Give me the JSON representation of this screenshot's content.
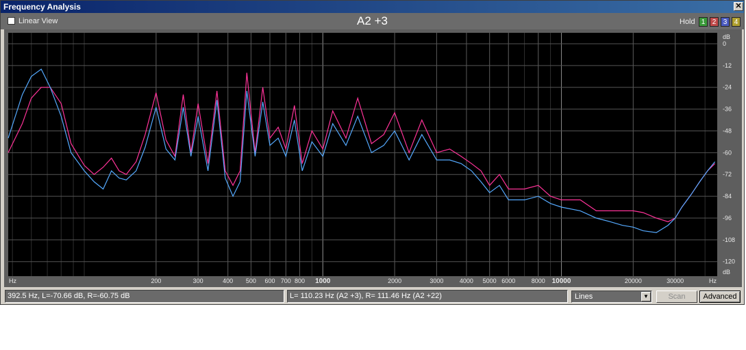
{
  "window": {
    "title": "Frequency Analysis"
  },
  "toolbar": {
    "linear_view_label": "Linear View",
    "linear_view_checked": false,
    "note_label": "A2 +3",
    "hold_label": "Hold",
    "hold_buttons": [
      {
        "label": "1",
        "color": "#3a9a3a"
      },
      {
        "label": "2",
        "color": "#c04a4a"
      },
      {
        "label": "3",
        "color": "#4a5ac0"
      },
      {
        "label": "4",
        "color": "#b0a030"
      }
    ]
  },
  "colors": {
    "left_channel": "#ff3399",
    "right_channel": "#55aaff",
    "plot_bg": "#000000",
    "grid": "#555555"
  },
  "chart_data": {
    "type": "line",
    "x_scale": "log",
    "x_range": [
      48,
      45000
    ],
    "y_range": [
      -128,
      6
    ],
    "x_axis_label": "Hz",
    "y_axis_label": "dB",
    "x_ticks": [
      {
        "label": "200",
        "value": 200
      },
      {
        "label": "300",
        "value": 300
      },
      {
        "label": "400",
        "value": 400
      },
      {
        "label": "500",
        "value": 500
      },
      {
        "label": "600",
        "value": 600
      },
      {
        "label": "700",
        "value": 700
      },
      {
        "label": "800",
        "value": 800
      },
      {
        "label": "1000",
        "value": 1000
      },
      {
        "label": "2000",
        "value": 2000
      },
      {
        "label": "3000",
        "value": 3000
      },
      {
        "label": "4000",
        "value": 4000
      },
      {
        "label": "5000",
        "value": 5000
      },
      {
        "label": "6000",
        "value": 6000
      },
      {
        "label": "8000",
        "value": 8000
      },
      {
        "label": "10000",
        "value": 10000
      },
      {
        "label": "20000",
        "value": 20000
      },
      {
        "label": "30000",
        "value": 30000
      }
    ],
    "y_ticks": [
      "0",
      "-12",
      "-24",
      "-36",
      "-48",
      "-60",
      "-72",
      "-84",
      "-96",
      "-108",
      "-120"
    ],
    "series": [
      {
        "name": "L",
        "x": [
          48,
          55,
          60,
          66,
          72,
          80,
          88,
          100,
          110,
          120,
          130,
          140,
          150,
          165,
          180,
          200,
          220,
          240,
          260,
          280,
          300,
          330,
          360,
          390,
          420,
          450,
          480,
          520,
          560,
          600,
          650,
          700,
          760,
          820,
          900,
          1000,
          1100,
          1250,
          1400,
          1600,
          1800,
          2000,
          2300,
          2600,
          3000,
          3400,
          3800,
          4200,
          4600,
          5000,
          5500,
          6000,
          7000,
          8000,
          9000,
          10000,
          12000,
          14000,
          16000,
          18000,
          20000,
          22000,
          25000,
          28000,
          30000,
          32000,
          35000,
          38000,
          41000,
          44000
        ],
        "y": [
          -60,
          -44,
          -30,
          -24,
          -24,
          -33,
          -55,
          -67,
          -72,
          -68,
          -63,
          -70,
          -72,
          -65,
          -50,
          -27,
          -53,
          -62,
          -28,
          -60,
          -33,
          -66,
          -26,
          -70,
          -78,
          -70,
          -16,
          -60,
          -24,
          -52,
          -46,
          -58,
          -34,
          -66,
          -48,
          -58,
          -37,
          -52,
          -30,
          -55,
          -50,
          -38,
          -60,
          -42,
          -60,
          -58,
          -62,
          -66,
          -70,
          -78,
          -72,
          -80,
          -80,
          -78,
          -84,
          -86,
          -86,
          -92,
          -92,
          -92,
          -92,
          -93,
          -96,
          -98,
          -96,
          -90,
          -83,
          -76,
          -70,
          -66
        ]
      },
      {
        "name": "R",
        "x": [
          48,
          55,
          60,
          66,
          72,
          80,
          88,
          100,
          110,
          120,
          130,
          140,
          150,
          165,
          180,
          200,
          220,
          240,
          260,
          280,
          300,
          330,
          360,
          390,
          420,
          450,
          480,
          520,
          560,
          600,
          650,
          700,
          760,
          820,
          900,
          1000,
          1100,
          1250,
          1400,
          1600,
          1800,
          2000,
          2300,
          2600,
          3000,
          3400,
          3800,
          4200,
          4600,
          5000,
          5500,
          6000,
          7000,
          8000,
          9000,
          10000,
          12000,
          14000,
          16000,
          18000,
          20000,
          22000,
          25000,
          28000,
          30000,
          32000,
          35000,
          38000,
          41000,
          44000
        ],
        "y": [
          -52,
          -28,
          -18,
          -14,
          -24,
          -40,
          -60,
          -70,
          -76,
          -80,
          -70,
          -74,
          -75,
          -70,
          -57,
          -35,
          -58,
          -64,
          -35,
          -62,
          -40,
          -70,
          -31,
          -74,
          -84,
          -76,
          -26,
          -62,
          -32,
          -56,
          -52,
          -62,
          -42,
          -70,
          -54,
          -62,
          -44,
          -56,
          -40,
          -60,
          -56,
          -48,
          -64,
          -50,
          -64,
          -64,
          -66,
          -70,
          -76,
          -82,
          -78,
          -86,
          -86,
          -84,
          -88,
          -90,
          -92,
          -96,
          -98,
          -100,
          -101,
          -103,
          -104,
          -100,
          -96,
          -90,
          -83,
          -76,
          -70,
          -65
        ]
      }
    ]
  },
  "status": {
    "cursor_readout": "392.5 Hz, L=-70.66 dB, R=-60.75 dB",
    "peak_readout": "L= 110.23 Hz (A2 +3), R= 111.46 Hz (A2 +22)",
    "display_mode": "Lines",
    "scan_label": "Scan",
    "advanced_label": "Advanced"
  }
}
